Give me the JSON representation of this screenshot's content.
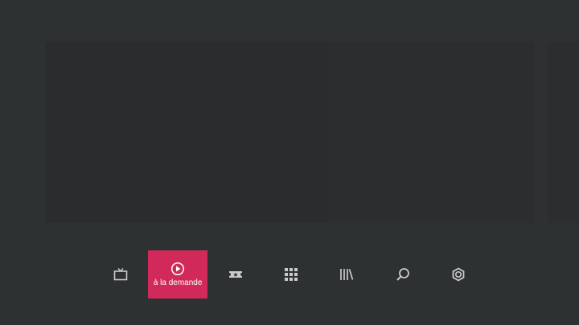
{
  "colors": {
    "background": "#2e3132",
    "card": "#2b2d2e",
    "active_tab": "#d12a5a",
    "icon": "#c9cacb"
  },
  "nav": {
    "items": [
      {
        "icon": "tv-icon",
        "label": ""
      },
      {
        "icon": "play-circle-icon",
        "label": "à la demande",
        "active": true
      },
      {
        "icon": "ticket-icon",
        "label": ""
      },
      {
        "icon": "apps-grid-icon",
        "label": ""
      },
      {
        "icon": "library-icon",
        "label": ""
      },
      {
        "icon": "search-icon",
        "label": ""
      },
      {
        "icon": "settings-icon",
        "label": ""
      }
    ]
  }
}
